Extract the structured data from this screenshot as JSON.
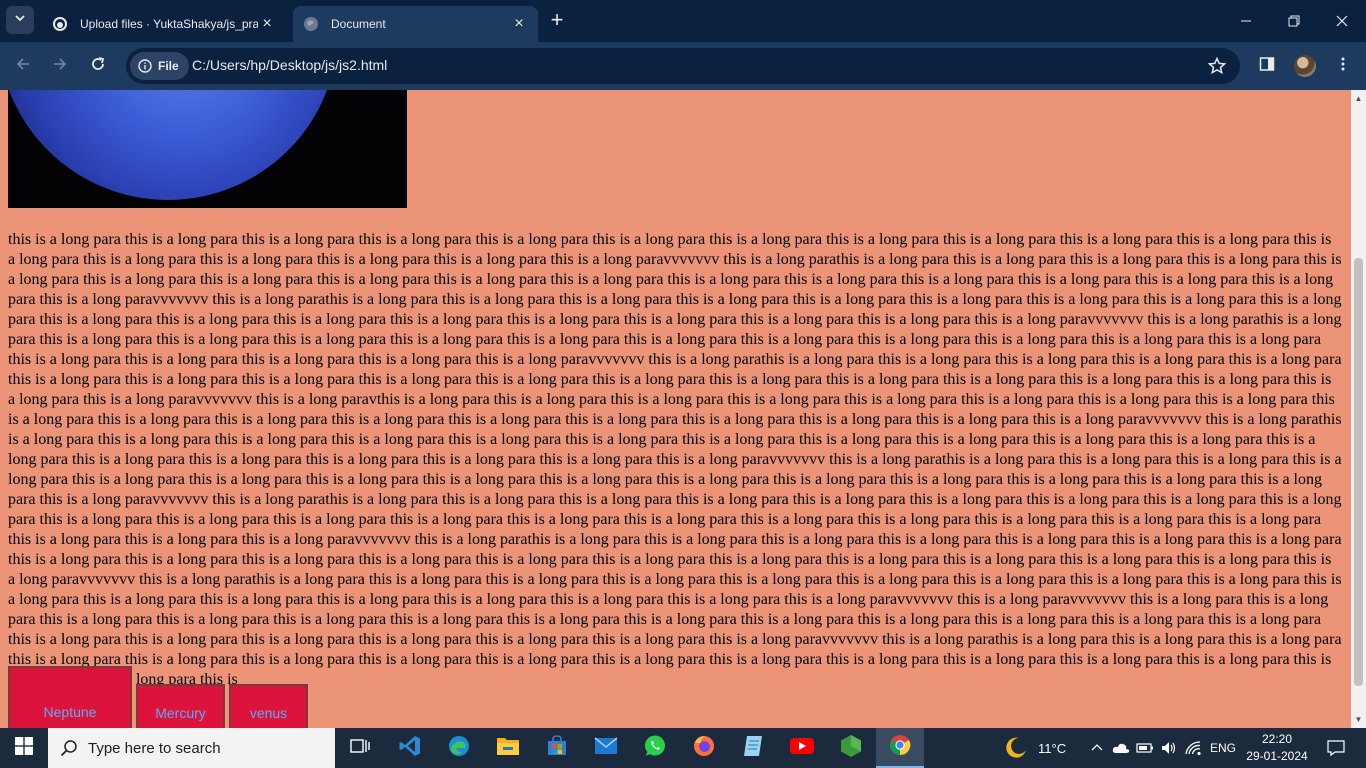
{
  "browser": {
    "tabs": [
      {
        "title": "Upload files · YuktaShakya/js_practice",
        "active": false
      },
      {
        "title": "Document",
        "active": true
      }
    ],
    "site_chip_label": "File",
    "url": "C:/Users/hp/Desktop/js/js2.html"
  },
  "page": {
    "paragraph": "this is a long para this is a long para this is a long para this is a long para this is a long para this is a long para this is a long para this is a long para this is a long para this is a long para this is a long para this is a long para this is a long para this is a long para this is a long para this is a long para this is a long paravvvvvvv this is a long parathis is a long para this is a long para this is a long para this is a long para this is a long para this is a long para this is a long para this is a long para this is a long para this is a long para this is a long para this is a long para this is a long para this is a long para this is a long para this is a long para this is a long paravvvvvvv this is a long parathis is a long para this is a long para this is a long para this is a long para this is a long para this is a long para this is a long para this is a long para this is a long para this is a long para this is a long para this is a long para this is a long para this is a long para this is a long para this is a long para this is a long para this is a long paravvvvvvv this is a long parathis is a long para this is a long para this is a long para this is a long para this is a long para this is a long para this is a long para this is a long para this is a long para this is a long para this is a long para this is a long para this is a long para this is a long para this is a long para this is a long para this is a long paravvvvvvv this is a long parathis is a long para this is a long para this is a long para this is a long para this is a long para this is a long para this is a long para this is a long para this is a long para this is a long para this is a long para this is a long para this is a long para this is a long para this is a long para this is a long para this is a long para this is a long paravvvvvvv this is a long paravthis is a long para this is a long para this is a long para this is a long para this is a long para this is a long para this is a long para this is a long para this is a long para this is a long para this is a long para this is a long para this is a long para this is a long para this is a long para this is a long para this is a long para this is a long paravvvvvvv this is a long parathis is a long para this is a long para this is a long para this is a long para this is a long para this is a long para this is a long para this is a long para this is a long para this is a long para this is a long para this is a long para this is a long para this is a long para this is a long para this is a long para this is a long para this is a long paravvvvvvv this is a long parathis is a long para this is a long para this is a long para this is a long para this is a long para this is a long para this is a long para this is a long para this is a long para this is a long para this is a long para this is a long para this is a long para this is a long para this is a long para this is a long paravvvvvvv this is a long parathis is a long para this is a long para this is a long para this is a long para this is a long para this is a long para this is a long para this is a long para this is a long para this is a long para this is a long para this is a long para this is a long para this is a long para this is a long para this is a long para this is a long para this is a long para this is a long para this is a long para this is a long para this is a long para this is a long paravvvvvvv this is a long parathis is a long para this is a long para this is a long para this is a long para this is a long para this is a long para this is a long para this is a long para this is a long para this is a long para this is a long para this is a long para this is a long para this is a long para this is a long para this is a long para this is a long para this is a long para this is a long paravvvvvvv this is a long parathis is a long para this is a long para this is a long para this is a long para this is a long para this is a long para this is a long para this is a long para this is a long para this is a long para this is a long para this is a long para this is a long para this is a long para this is a long para this is a long para this is a long paravvvvvvv this is a long paravvvvvvv this is a long para this is a long para this is a long para this is a long para this is a long para this is a long para this is a long para this is a long para this is a long para this is a long para this is a long para this is a long para this is a long para this is a long para this is a long para this is a long para this is a long para this is a long para this is a long para this is a long paravvvvvvv this is a long parathis is a long para this is a long para this is a long para this is a long para this is a long para this is a long para this is a long para this is a long para this is a long para this is a long para this is a long para this is a long para this is a long para this is a long para this is a long para this is a long para this is",
    "buttons": [
      {
        "label": "Neptune"
      },
      {
        "label": "Mercury"
      },
      {
        "label": "venus"
      }
    ]
  },
  "taskbar": {
    "search_placeholder": "Type here to search",
    "weather": "11°C",
    "language": "ENG",
    "time": "22:20",
    "date": "29-01-2024"
  }
}
